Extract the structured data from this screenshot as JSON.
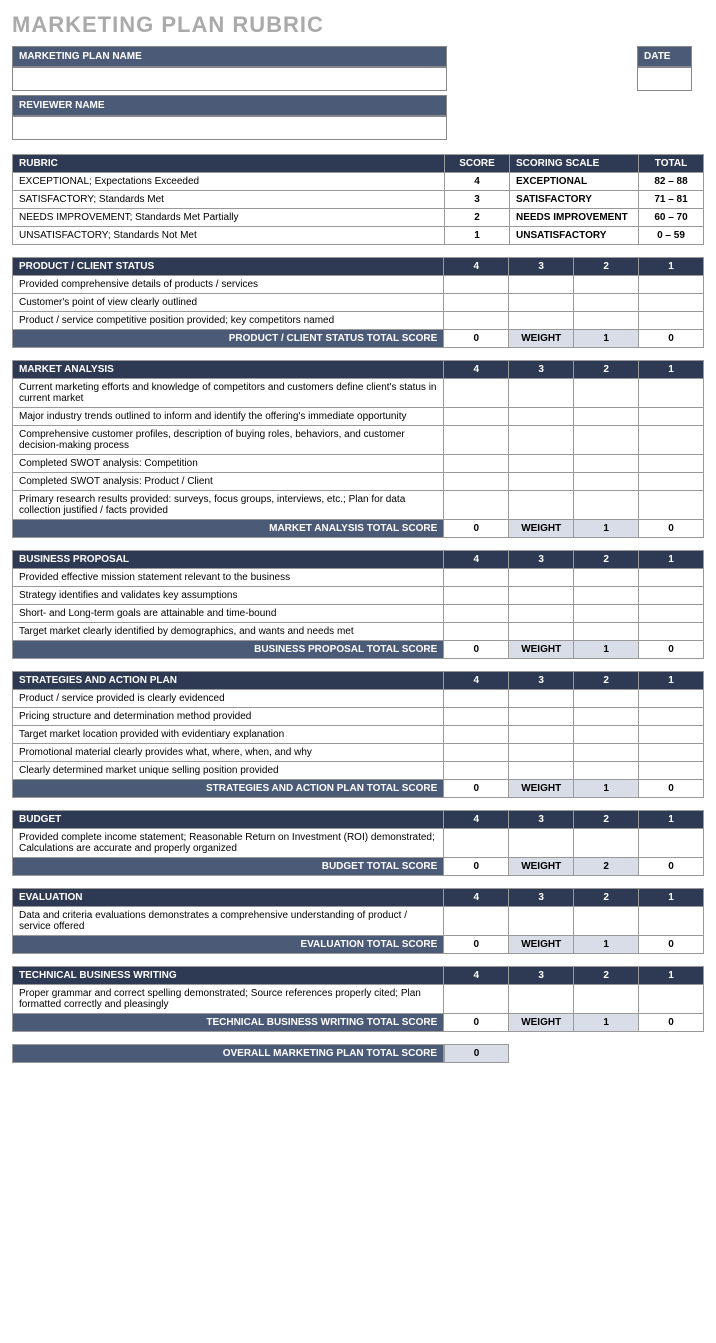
{
  "title": "MARKETING PLAN RUBRIC",
  "headers": {
    "plan_name": "MARKETING PLAN NAME",
    "date": "DATE",
    "reviewer": "REVIEWER NAME",
    "rubric": "RUBRIC",
    "score": "SCORE",
    "scoring_scale": "SCORING SCALE",
    "total": "TOTAL",
    "weight": "WEIGHT",
    "overall": "OVERALL MARKETING PLAN TOTAL SCORE"
  },
  "rubric": [
    {
      "desc": "EXCEPTIONAL; Expectations Exceeded",
      "score": "4",
      "scale": "EXCEPTIONAL",
      "total": "82 – 88"
    },
    {
      "desc": "SATISFACTORY; Standards Met",
      "score": "3",
      "scale": "SATISFACTORY",
      "total": "71 – 81"
    },
    {
      "desc": "NEEDS IMPROVEMENT; Standards Met Partially",
      "score": "2",
      "scale": "NEEDS IMPROVEMENT",
      "total": "60 – 70"
    },
    {
      "desc": "UNSATISFACTORY; Standards Not Met",
      "score": "1",
      "scale": "UNSATISFACTORY",
      "total": "0 – 59"
    }
  ],
  "sections": [
    {
      "name": "PRODUCT / CLIENT STATUS",
      "cols": [
        "4",
        "3",
        "2",
        "1"
      ],
      "rows": [
        "Provided comprehensive details of products / services",
        "Customer's point of view clearly outlined",
        "Product / service competitive position provided; key competitors named"
      ],
      "total_label": "PRODUCT / CLIENT STATUS TOTAL SCORE",
      "total_score": "0",
      "weight": "1",
      "final": "0"
    },
    {
      "name": "MARKET ANALYSIS",
      "cols": [
        "4",
        "3",
        "2",
        "1"
      ],
      "rows": [
        "Current marketing efforts and knowledge of competitors and customers define client's status in current market",
        "Major industry trends outlined to inform and identify the offering's immediate opportunity",
        "Comprehensive customer profiles, description of buying roles, behaviors, and customer decision-making process",
        "Completed SWOT analysis: Competition",
        "Completed SWOT analysis: Product / Client",
        "Primary research results provided: surveys, focus groups, interviews, etc.; Plan for data collection justified / facts provided"
      ],
      "total_label": "MARKET ANALYSIS TOTAL SCORE",
      "total_score": "0",
      "weight": "1",
      "final": "0"
    },
    {
      "name": "BUSINESS PROPOSAL",
      "cols": [
        "4",
        "3",
        "2",
        "1"
      ],
      "rows": [
        "Provided effective mission statement relevant to the business",
        "Strategy identifies and validates key assumptions",
        "Short- and Long-term goals are attainable and time-bound",
        "Target market clearly identified by demographics, and wants and needs met"
      ],
      "total_label": "BUSINESS PROPOSAL TOTAL SCORE",
      "total_score": "0",
      "weight": "1",
      "final": "0"
    },
    {
      "name": "STRATEGIES AND ACTION PLAN",
      "cols": [
        "4",
        "3",
        "2",
        "1"
      ],
      "rows": [
        "Product / service provided is clearly evidenced",
        "Pricing structure and determination method provided",
        "Target market location provided with evidentiary explanation",
        "Promotional material clearly provides what, where, when, and why",
        "Clearly determined market unique selling position provided"
      ],
      "total_label": "STRATEGIES AND ACTION PLAN TOTAL SCORE",
      "total_score": "0",
      "weight": "1",
      "final": "0"
    },
    {
      "name": "BUDGET",
      "cols": [
        "4",
        "3",
        "2",
        "1"
      ],
      "rows": [
        "Provided complete income statement; Reasonable Return on Investment (ROI) demonstrated; Calculations are accurate and properly organized"
      ],
      "total_label": "BUDGET TOTAL SCORE",
      "total_score": "0",
      "weight": "2",
      "final": "0"
    },
    {
      "name": "EVALUATION",
      "cols": [
        "4",
        "3",
        "2",
        "1"
      ],
      "rows": [
        "Data and criteria evaluations demonstrates a comprehensive understanding of product / service offered"
      ],
      "total_label": "EVALUATION TOTAL SCORE",
      "total_score": "0",
      "weight": "1",
      "final": "0"
    },
    {
      "name": "TECHNICAL BUSINESS WRITING",
      "cols": [
        "4",
        "3",
        "2",
        "1"
      ],
      "rows": [
        "Proper grammar and correct spelling demonstrated; Source references properly cited; Plan formatted correctly and pleasingly"
      ],
      "total_label": "TECHNICAL BUSINESS WRITING TOTAL SCORE",
      "total_score": "0",
      "weight": "1",
      "final": "0"
    }
  ],
  "overall_score": "0"
}
